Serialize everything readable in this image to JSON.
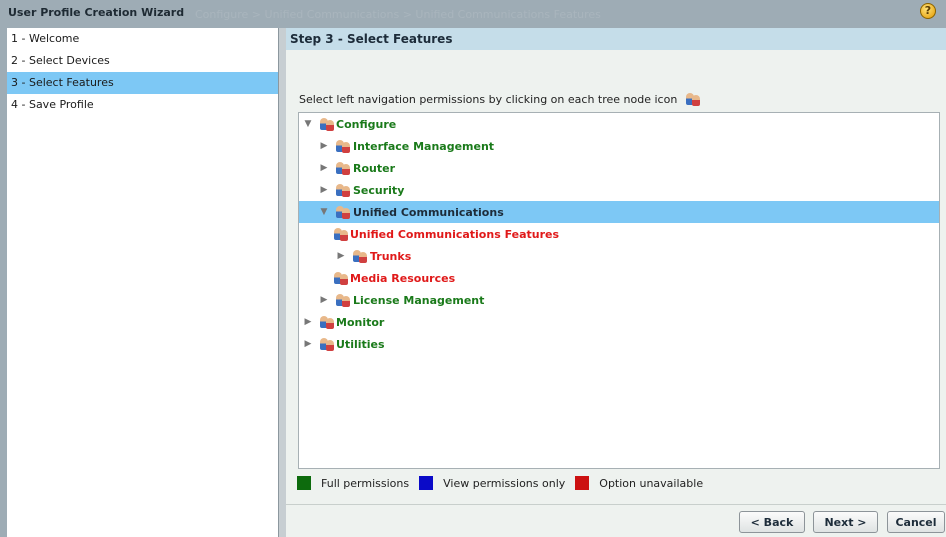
{
  "window": {
    "title": "User Profile Creation Wizard",
    "background_breadcrumb": "Configure > Unified Communications > Unified Communications Features",
    "help_icon": "question-icon"
  },
  "steps": [
    {
      "label": "1 - Welcome"
    },
    {
      "label": "2 - Select Devices"
    },
    {
      "label": "3 - Select Features",
      "active": true
    },
    {
      "label": "4 - Save Profile"
    }
  ],
  "main": {
    "step_title": "Step 3 - Select Features",
    "instruction": "Select left navigation permissions by clicking on each tree node icon"
  },
  "tree": [
    {
      "label": "Configure",
      "level": 0,
      "expanded": true,
      "permission": "full"
    },
    {
      "label": "Interface Management",
      "level": 1,
      "expanded": false,
      "permission": "full"
    },
    {
      "label": "Router",
      "level": 1,
      "expanded": false,
      "permission": "full"
    },
    {
      "label": "Security",
      "level": 1,
      "expanded": false,
      "permission": "full"
    },
    {
      "label": "Unified Communications",
      "level": 1,
      "expanded": true,
      "selected": true
    },
    {
      "label": "Unified Communications Features",
      "level": 2,
      "leaf": true,
      "permission": "unavailable"
    },
    {
      "label": "Trunks",
      "level": 2,
      "expanded": false,
      "permission": "unavailable"
    },
    {
      "label": "Media Resources",
      "level": 2,
      "leaf": true,
      "permission": "unavailable"
    },
    {
      "label": "License Management",
      "level": 1,
      "expanded": false,
      "permission": "full"
    },
    {
      "label": "Monitor",
      "level": 0,
      "expanded": false,
      "permission": "full"
    },
    {
      "label": "Utilities",
      "level": 0,
      "expanded": false,
      "permission": "full"
    }
  ],
  "legend": [
    {
      "label": "Full permissions",
      "color": "#0d6b0d"
    },
    {
      "label": "View permissions only",
      "color": "#0a0ac8"
    },
    {
      "label": "Option unavailable",
      "color": "#cc1111"
    }
  ],
  "buttons": {
    "back": "< Back",
    "next": "Next >",
    "cancel": "Cancel"
  }
}
